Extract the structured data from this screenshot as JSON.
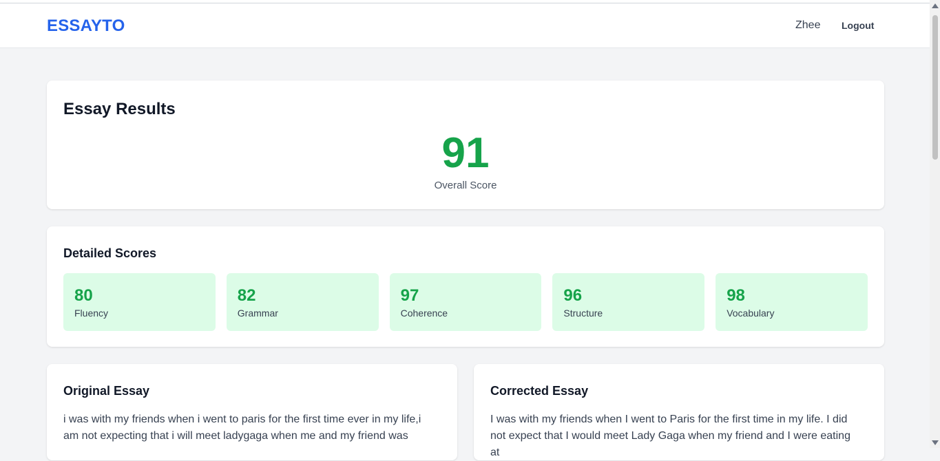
{
  "navbar": {
    "brand": "ESSAYTO",
    "user": "Zhee",
    "logout": "Logout"
  },
  "results": {
    "title": "Essay Results",
    "overall_score": "91",
    "overall_label": "Overall Score"
  },
  "detailed": {
    "title": "Detailed Scores",
    "scores": [
      {
        "value": "80",
        "label": "Fluency"
      },
      {
        "value": "82",
        "label": "Grammar"
      },
      {
        "value": "97",
        "label": "Coherence"
      },
      {
        "value": "96",
        "label": "Structure"
      },
      {
        "value": "98",
        "label": "Vocabulary"
      }
    ]
  },
  "original": {
    "title": "Original Essay",
    "text": "i was with my friends when i went to paris for the first time ever in my life,i am not expecting that i will meet ladygaga when me and my friend was"
  },
  "corrected": {
    "title": "Corrected Essay",
    "text": "I was with my friends when I went to Paris for the first time in my life. I did not expect that I would meet Lady Gaga when my friend and I were eating at"
  },
  "colors": {
    "brand": "#2563eb",
    "score_green": "#16a34a",
    "score_box_bg": "#dcfce7",
    "page_bg": "#f3f4f6"
  }
}
